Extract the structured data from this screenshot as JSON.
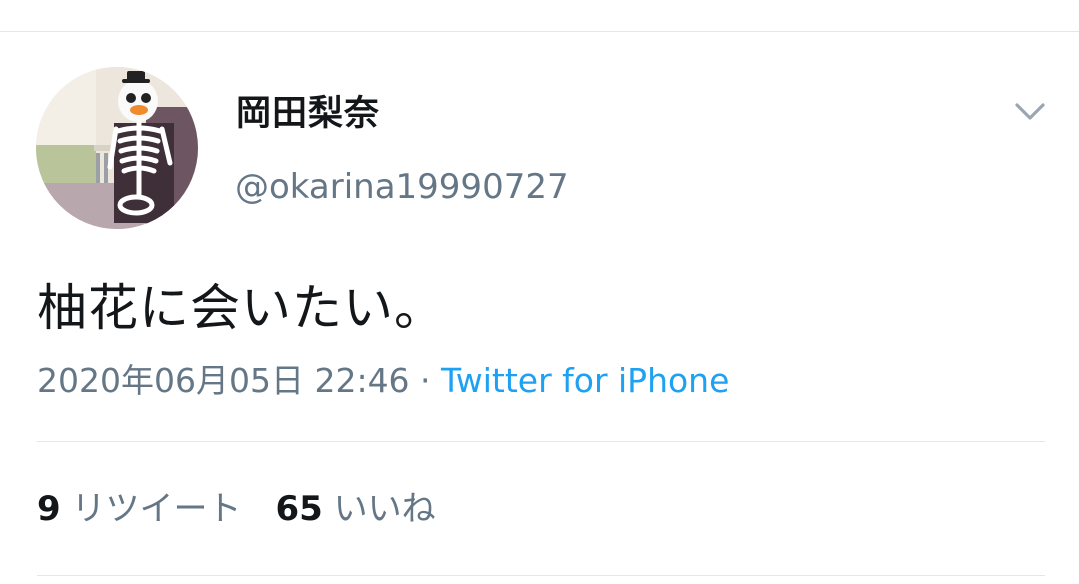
{
  "tweet": {
    "author_name": "岡田梨奈",
    "author_handle": "@okarina19990727",
    "text": "柚花に会いたい。",
    "timestamp": "2020年06月05日 22:46",
    "separator": " · ",
    "source": "Twitter for iPhone",
    "retweet_count": "9",
    "retweet_label": "リツイート",
    "like_count": "65",
    "like_label": "いいね"
  },
  "icons": {
    "menu": "chevron-down-icon",
    "avatar": "avatar-image"
  },
  "colors": {
    "text_primary": "#14171a",
    "text_secondary": "#657786",
    "link": "#1da1f2",
    "divider": "#e1e8ed"
  }
}
